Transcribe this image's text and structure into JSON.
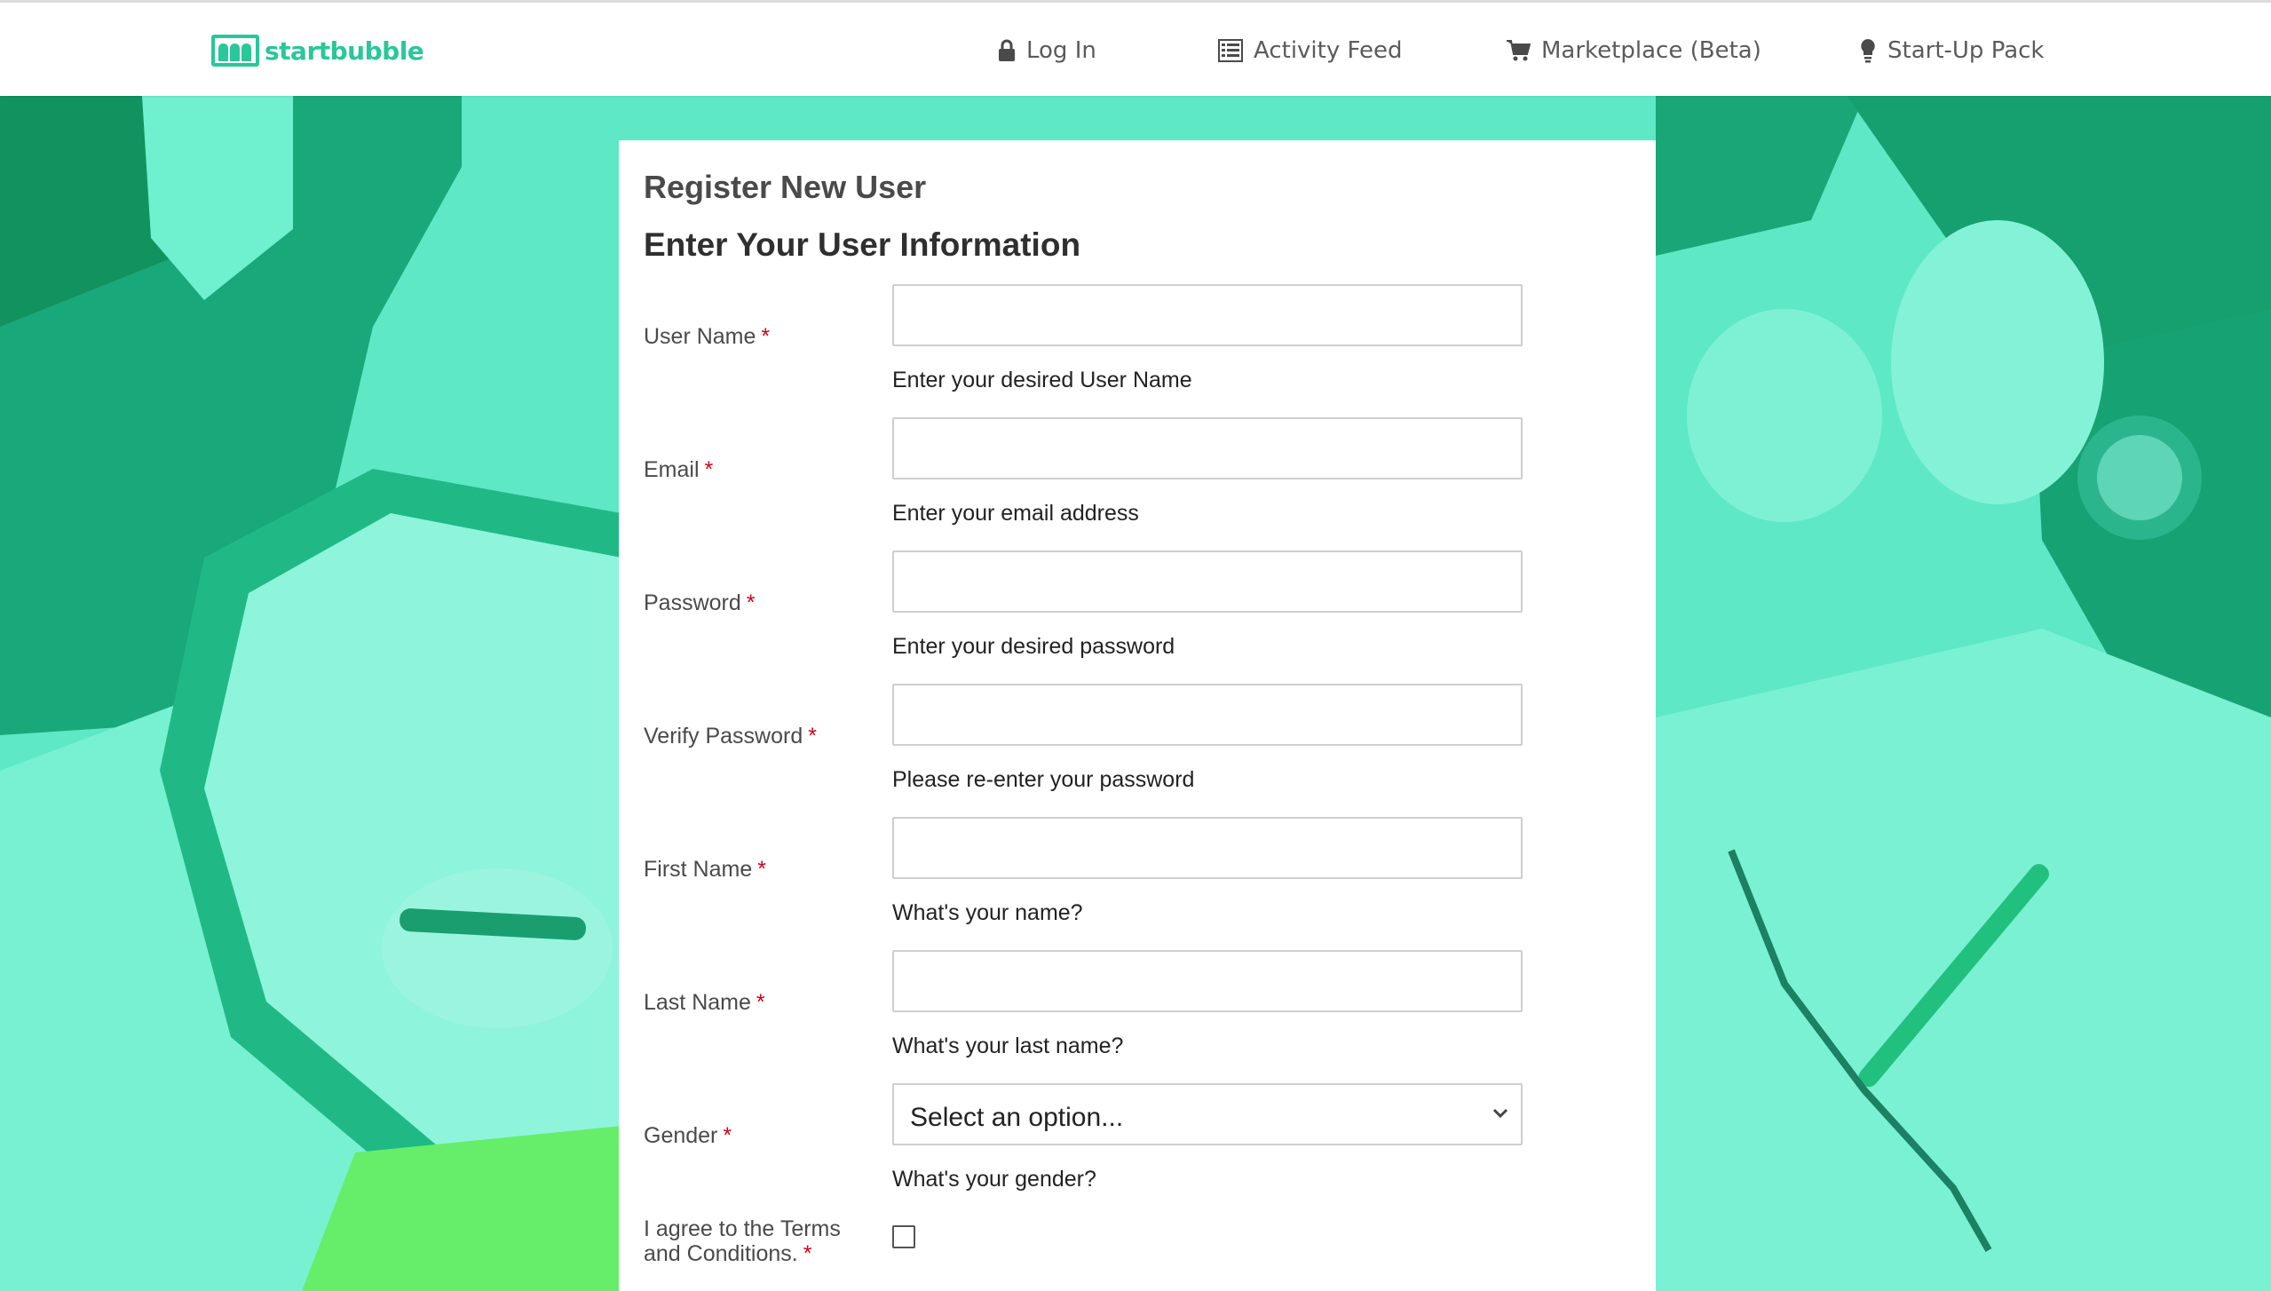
{
  "header": {
    "brand": "startbubble",
    "nav": {
      "login": "Log In",
      "activity_feed": "Activity Feed",
      "marketplace": "Marketplace (Beta)",
      "startup_pack": "Start-Up Pack"
    }
  },
  "form": {
    "title": "Register New User",
    "subtitle": "Enter Your User Information",
    "required_marker": "*",
    "fields": {
      "username": {
        "label": "User Name",
        "value": "",
        "help": "Enter your desired User Name"
      },
      "email": {
        "label": "Email",
        "value": "",
        "help": "Enter your email address"
      },
      "password": {
        "label": "Password",
        "value": "",
        "help": "Enter your desired password"
      },
      "verify_password": {
        "label": "Verify Password",
        "value": "",
        "help": "Please re-enter your password"
      },
      "first_name": {
        "label": "First Name",
        "value": "",
        "help": "What's your name?"
      },
      "last_name": {
        "label": "Last Name",
        "value": "",
        "help": "What's your last name?"
      },
      "gender": {
        "label": "Gender",
        "selected": "Select an option...",
        "help": "What's your gender?"
      },
      "terms": {
        "label_line1": "I agree to the Terms",
        "label_line2": "and Conditions.",
        "checked": false
      }
    }
  },
  "colors": {
    "brand": "#29c79a",
    "background_overlay": "#5ee8c6",
    "required": "#d0021b"
  },
  "icons": {
    "login": "lock-icon",
    "activity_feed": "list-icon",
    "marketplace": "cart-icon",
    "startup_pack": "lightbulb-icon",
    "gender_select": "chevron-down-icon"
  }
}
